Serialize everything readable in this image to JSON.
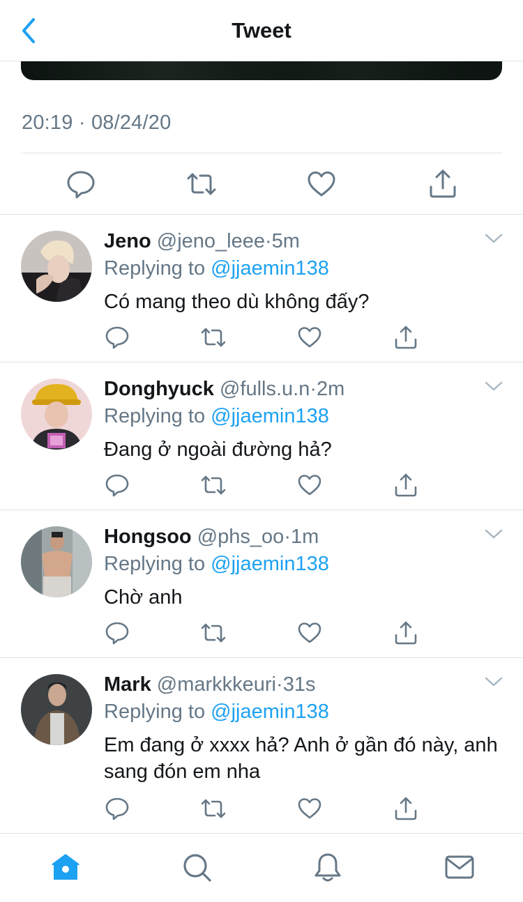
{
  "header": {
    "title": "Tweet"
  },
  "tweet": {
    "timestamp": "20:19 · 08/24/20",
    "media_tint": "#0d1411"
  },
  "colors": {
    "accent": "#1da1f2",
    "muted": "#657786",
    "text": "#14171a",
    "divider": "#dfe3e6"
  },
  "replies": [
    {
      "name": "Jeno",
      "handle": "@jeno_leee",
      "dot": "·",
      "time": "5m",
      "replying_prefix": "Replying to",
      "mention": "@jjaemin138",
      "text": "Có mang theo dù không đấy?"
    },
    {
      "name": "Donghyuck",
      "handle": "@fulls.u.n",
      "dot": "·",
      "time": "2m",
      "replying_prefix": "Replying to",
      "mention": "@jjaemin138",
      "text": "Đang ở ngoài đường hả?"
    },
    {
      "name": "Hongsoo",
      "handle": "@phs_oo",
      "dot": "·",
      "time": "1m",
      "replying_prefix": "Replying to",
      "mention": "@jjaemin138",
      "text": "Chờ anh"
    },
    {
      "name": "Mark",
      "handle": "@markkkeuri",
      "dot": "·",
      "time": "31s",
      "replying_prefix": "Replying to",
      "mention": "@jjaemin138",
      "text": "Em đang ở xxxx hả? Anh ở gần đó này, anh sang đón em nha"
    }
  ],
  "tabs": [
    "home-icon",
    "search-icon",
    "notifications-icon",
    "messages-icon"
  ]
}
